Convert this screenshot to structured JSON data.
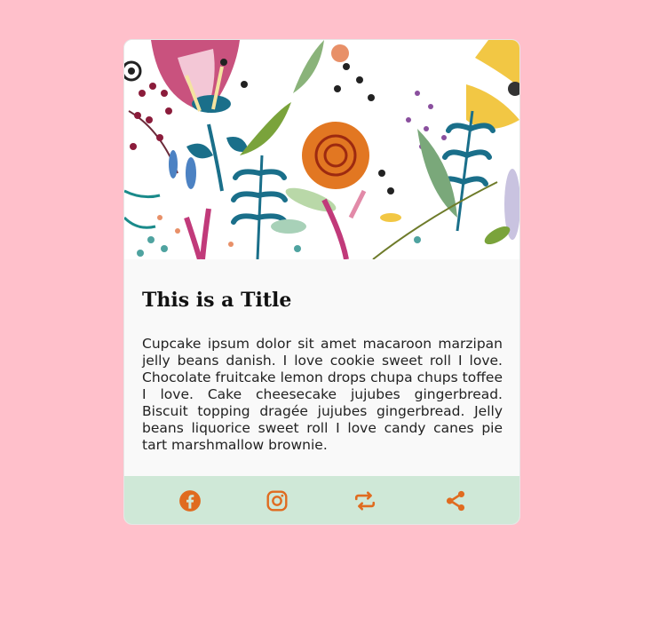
{
  "card": {
    "title": "This is a Title",
    "description": "Cupcake ipsum dolor sit amet macaroon marzipan jelly beans danish. I love cookie sweet roll I love. Chocolate fruitcake lemon drops chupa chups toffee I love. Cake cheesecake jujubes gingerbread. Biscuit topping dragée jujubes gingerbread. Jelly beans liquorice sweet roll I love candy canes pie tart marshmallow brownie."
  },
  "footer": {
    "icons": [
      "facebook-icon",
      "instagram-icon",
      "repost-icon",
      "share-icon"
    ],
    "icon_color": "#e06b1f",
    "background": "#cfe8d7"
  },
  "colors": {
    "page_background": "#ffc0cb",
    "card_background": "#f9f9f9"
  }
}
